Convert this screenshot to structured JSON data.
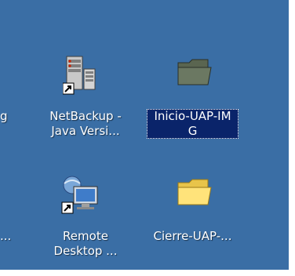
{
  "desktop": {
    "color": "#3a6ea5",
    "icons": [
      {
        "name": "NetBackup -\nJava Versi...",
        "icon": "server-tower-icon"
      },
      {
        "name": "Inicio-UAP-IM\nG",
        "icon": "folder-icon",
        "selected": true
      },
      {
        "name": "Remote\nDesktop ...",
        "icon": "remote-desktop-icon"
      },
      {
        "name": "Cierre-UAP-...",
        "icon": "folder-icon"
      }
    ],
    "left_column": {
      "top_fragment": "g",
      "bottom_fragment": "..."
    }
  }
}
